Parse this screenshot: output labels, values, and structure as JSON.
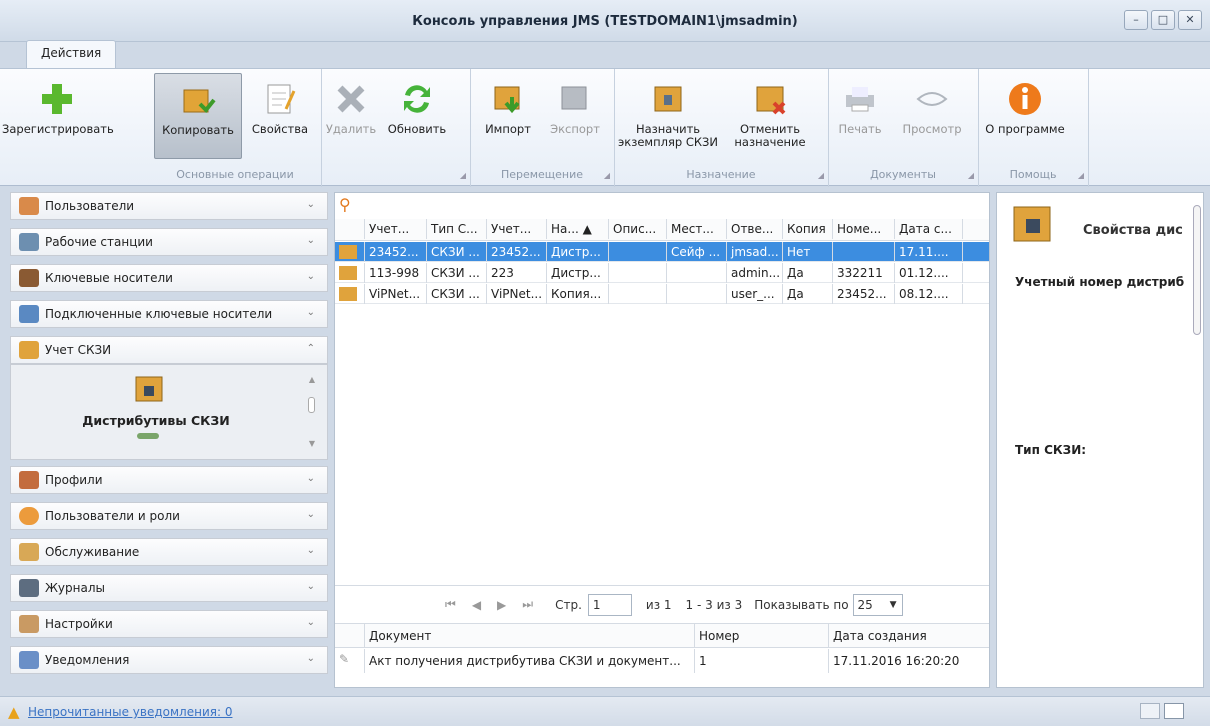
{
  "window": {
    "title": "Консоль управления JMS (TESTDOMAIN1\\jmsadmin)"
  },
  "tabs": [
    {
      "label": "Действия"
    }
  ],
  "ribbon": {
    "groups": [
      {
        "label": "Основные операции",
        "buttons": [
          {
            "label": "Зарегистрировать",
            "icon": "plus-icon"
          },
          {
            "label": "Копировать",
            "icon": "copy-box-icon",
            "selected": true
          },
          {
            "label": "Свойства",
            "icon": "notepad-icon"
          },
          {
            "label": "Удалить",
            "icon": "delete-x-icon",
            "disabled": true
          },
          {
            "label": "Обновить",
            "icon": "refresh-icon"
          }
        ]
      },
      {
        "label": "Перемещение",
        "buttons": [
          {
            "label": "Импорт",
            "icon": "import-icon"
          },
          {
            "label": "Экспорт",
            "icon": "export-icon",
            "disabled": true
          }
        ]
      },
      {
        "label": "Назначение",
        "buttons": [
          {
            "label": "Назначить",
            "label2": "экземпляр СКЗИ",
            "icon": "assign-icon"
          },
          {
            "label": "Отменить",
            "label2": "назначение",
            "icon": "unassign-icon"
          }
        ]
      },
      {
        "label": "Документы",
        "buttons": [
          {
            "label": "Печать",
            "icon": "printer-icon",
            "disabled": true
          },
          {
            "label": "Просмотр",
            "icon": "preview-icon",
            "disabled": true
          }
        ]
      },
      {
        "label": "Помощь",
        "buttons": [
          {
            "label": "О программе",
            "icon": "info-icon"
          }
        ]
      }
    ]
  },
  "sidebar": {
    "items": [
      {
        "label": "Пользователи",
        "icon": "users-icon"
      },
      {
        "label": "Рабочие станции",
        "icon": "workstations-icon"
      },
      {
        "label": "Ключевые носители",
        "icon": "key-media-icon"
      },
      {
        "label": "Подключенные ключевые носители",
        "icon": "connected-media-icon"
      },
      {
        "label": "Учет СКЗИ",
        "icon": "skzi-icon",
        "expanded": true
      },
      {
        "label": "Профили",
        "icon": "profiles-icon"
      },
      {
        "label": "Пользователи и роли",
        "icon": "roles-icon"
      },
      {
        "label": "Обслуживание",
        "icon": "maintenance-icon"
      },
      {
        "label": "Журналы",
        "icon": "logs-icon"
      },
      {
        "label": "Настройки",
        "icon": "settings-icon"
      },
      {
        "label": "Уведомления",
        "icon": "notifications-icon"
      }
    ],
    "expanded_item": {
      "label": "Дистрибутивы СКЗИ",
      "icon": "lock-box-icon"
    }
  },
  "grid": {
    "columns": [
      "Учет...",
      "Тип С...",
      "Учет...",
      "На... ▲",
      "Опис...",
      "Мест...",
      "Отве...",
      "Копия",
      "Номе...",
      "Дата с..."
    ],
    "rows": [
      [
        "23452...",
        "СКЗИ ...",
        "23452...",
        "Дистр...",
        "",
        "Сейф ...",
        "jmsad...",
        "Нет",
        "",
        "17.11...."
      ],
      [
        "113-998",
        "СКЗИ ...",
        "223",
        "Дистр...",
        "",
        "",
        "admin...",
        "Да",
        "332211",
        "01.12...."
      ],
      [
        "ViPNet...",
        "СКЗИ ...",
        "ViPNet...",
        "Копия...",
        "",
        "",
        "user_...",
        "Да",
        "23452...",
        "08.12...."
      ]
    ]
  },
  "pager": {
    "page_label": "Стр.",
    "page": "1",
    "of": "из 1",
    "range": "1 - 3 из 3",
    "show_label": "Показывать по",
    "page_size": "25"
  },
  "documents": {
    "columns": [
      "Документ",
      "Номер",
      "Дата создания"
    ],
    "rows": [
      [
        "Акт получения дистрибутива СКЗИ и документ...",
        "1",
        "17.11.2016 16:20:20"
      ]
    ]
  },
  "properties": {
    "title": "Свойства дис",
    "field1": "Учетный номер дистриб",
    "field2": "Тип СКЗИ:"
  },
  "status": {
    "link": "Непрочитанные уведомления: 0"
  },
  "colors": {
    "accent": "#3c8de0",
    "warning": "#e8a21c"
  }
}
